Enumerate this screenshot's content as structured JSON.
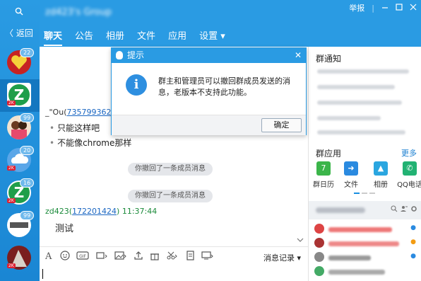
{
  "header": {
    "group_title": "zd423's Group",
    "report_label": "举报",
    "tabs": [
      {
        "label": "聊天"
      },
      {
        "label": "公告"
      },
      {
        "label": "相册"
      },
      {
        "label": "文件"
      },
      {
        "label": "应用"
      },
      {
        "label": "设置 ▾"
      }
    ]
  },
  "sidebar": {
    "back_label": "〈 返回",
    "avatars": [
      {
        "badge": "22",
        "corner": ""
      },
      {
        "badge": "",
        "corner": "2K"
      },
      {
        "badge": "99",
        "corner": ""
      },
      {
        "badge": "20",
        "corner": "2K"
      },
      {
        "badge": "16",
        "corner": "2K"
      },
      {
        "badge": "99",
        "corner": ""
      },
      {
        "badge": "",
        "corner": "2K"
      }
    ]
  },
  "chat": {
    "msg1_sender": "_\"Ou(",
    "msg1_id": "735799362",
    "msg1_close": ")",
    "msg1_line1": "只能这样吧",
    "msg1_line2": "不能像chrome那样",
    "recall1": "你撤回了一条成员消息",
    "recall2": "你撤回了一条成员消息",
    "msg2_sender": "zd423(",
    "msg2_id": "172201424",
    "msg2_time": ")  11:37:44",
    "msg2_text": "测试"
  },
  "toolbar": {
    "history_label": "消息记录 ▾"
  },
  "right": {
    "notice_title": "群通知",
    "apps_title": "群应用",
    "apps_more": "更多",
    "apps": [
      {
        "label": "群日历",
        "color": "#3bb54a",
        "glyph": "7"
      },
      {
        "label": "文件",
        "color": "#2a8ae0",
        "glyph": "➜"
      },
      {
        "label": "相册",
        "color": "#2aa6e0",
        "glyph": "▲"
      },
      {
        "label": "QQ电话",
        "color": "#22b273",
        "glyph": "✆"
      }
    ]
  },
  "dialog": {
    "title": "提示",
    "message": "群主和管理员可以撤回群成员发送的消息，老版本不支持此功能。",
    "ok_label": "确定"
  },
  "colors": {
    "brand_blue": "#2a9be3",
    "link": "#1a66c2"
  }
}
